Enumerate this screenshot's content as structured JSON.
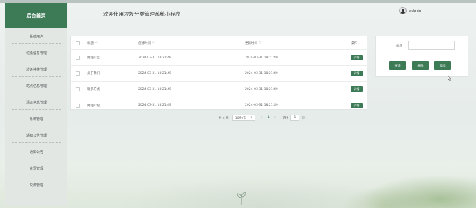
{
  "sidebar": {
    "logo": "后台首页",
    "items": [
      {
        "label": "系统用户"
      },
      {
        "label": "垃圾信息管理"
      },
      {
        "label": "垃圾种类管理"
      },
      {
        "label": "站点信息管理"
      },
      {
        "label": "清运信息管理"
      },
      {
        "label": "系统管理"
      },
      {
        "label": "通知公告管理"
      },
      {
        "label": "通知公告"
      },
      {
        "label": "资源管理"
      },
      {
        "label": "交流管理"
      }
    ]
  },
  "header": {
    "title": "欢迎使用垃圾分类管理系统小程序",
    "username": "admin"
  },
  "table": {
    "columns": [
      "标题",
      "创建时间",
      "更新时间",
      "操作"
    ],
    "sort_mark": "◇",
    "detail_label": "详情",
    "rows": [
      {
        "title": "网站公告",
        "created": "2024-03-31 18:21:49",
        "updated": "2024-03-31 18:21:49"
      },
      {
        "title": "关于我们",
        "created": "2024-03-31 18:21:49",
        "updated": "2024-03-31 18:21:49"
      },
      {
        "title": "联系方式",
        "created": "2024-03-31 18:21:49",
        "updated": "2024-03-31 18:21:49"
      },
      {
        "title": "网站介绍",
        "created": "2024-03-31 18:21:49",
        "updated": "2024-03-31 18:21:49"
      }
    ]
  },
  "pagination": {
    "total": "共 4 条",
    "page_size": "10条/页",
    "prev": "<",
    "current": "1",
    "next": ">",
    "goto_label": "前往",
    "goto_value": "1",
    "unit": "页"
  },
  "search": {
    "label": "标题",
    "value": "",
    "query_label": "查询",
    "delete_label": "删除",
    "add_label": "添加"
  },
  "colors": {
    "accent": "#3d7a56"
  }
}
